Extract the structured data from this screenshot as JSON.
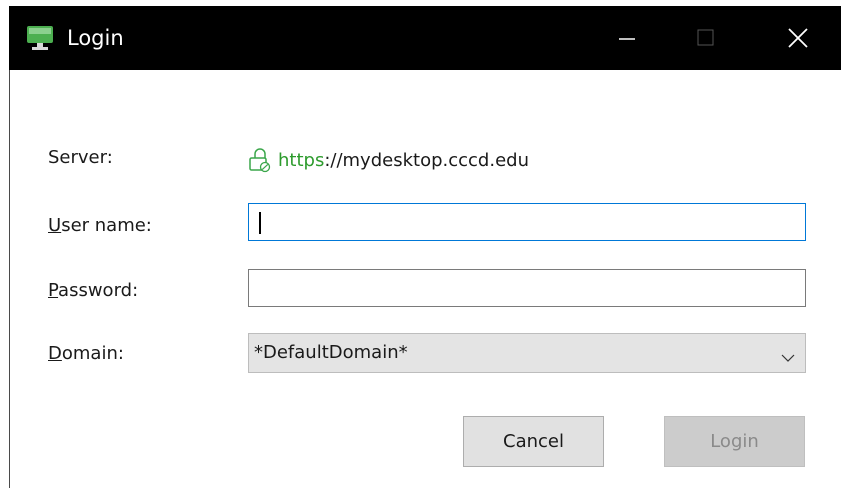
{
  "window": {
    "title": "Login",
    "icon": "monitor-icon",
    "controls": {
      "minimize": "minimize-icon",
      "maximize": "maximize-icon",
      "close": "close-icon"
    }
  },
  "form": {
    "server_label_pre": "",
    "server_label": "Server:",
    "server_url_scheme": "https",
    "server_url_rest": "://mydesktop.cccd.edu",
    "user_label_accel": "U",
    "user_label_rest": "ser name:",
    "user_value": "",
    "password_label_accel": "P",
    "password_label_rest": "assword:",
    "password_value": "",
    "domain_label_accel": "D",
    "domain_label_rest": "omain:",
    "domain_value": "*DefaultDomain*"
  },
  "buttons": {
    "cancel": "Cancel",
    "login": "Login"
  },
  "colors": {
    "titlebar": "#000000",
    "focus_border": "#0078d7",
    "secure_green": "#2d9b2d"
  }
}
